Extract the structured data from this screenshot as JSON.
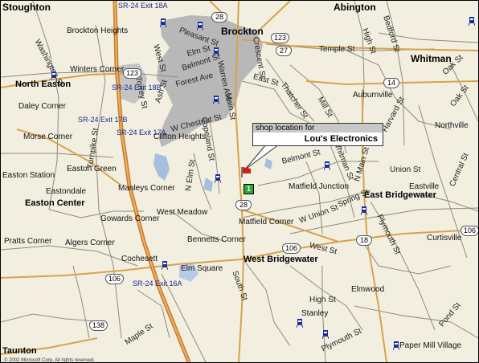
{
  "callout": {
    "header": "shop location for",
    "business": "Lou's Electronics"
  },
  "marker": {
    "number": "1",
    "flag_color": "#d51c1c",
    "pin_color": "#2ea82e"
  },
  "places_major": [
    "Stoughton",
    "Brockton",
    "Abington",
    "Whitman",
    "North Easton",
    "Easton Center",
    "East Bridgewater",
    "West Bridgewater",
    "Taunton"
  ],
  "places_minor": [
    "Brockton Heights",
    "Winters Corner",
    "Daley Corner",
    "Morse Corner",
    "Easton Station",
    "Easton Green",
    "Eastondale",
    "Clifton Heights",
    "Manleys Corner",
    "West Meadow",
    "Gowards Corner",
    "Bennetts Corner",
    "Matfield Corner",
    "Matfield Junction",
    "Northville",
    "Auburnville",
    "Eastville",
    "Curtisville",
    "Pratts Corner",
    "Algers Corner",
    "Cochesett",
    "Elm Square",
    "Elmwood",
    "Stanley",
    "Paper Mill Village"
  ],
  "streets": [
    "Washington St",
    "Pleasant St",
    "West St",
    "Belmont St",
    "Forest Ave",
    "Torrey St",
    "Elm St",
    "Ash St",
    "Main St",
    "Warren Ave",
    "W Chestnut St",
    "Copeland St",
    "Turnpike St",
    "N Elm St",
    "Thatcher St",
    "East St",
    "Temple St",
    "High St",
    "Bedford St",
    "Oak St",
    "Harvard St",
    "Belmont St",
    "Union St",
    "Central St",
    "Whitman St",
    "Spring St",
    "W Union St",
    "N Main St",
    "Plymouth St",
    "Pond St",
    "Maple St",
    "West St",
    "South St",
    "High St",
    "Plymouth St",
    "Oak St",
    "Mill St",
    "Crescent St"
  ],
  "routes": [
    "SR-24 Exit 18A",
    "SR-24 Exit 18B",
    "SR-24 Exit 17B",
    "SR-24 Exit 17A",
    "SR-24 Exit 16A"
  ],
  "route_shields": [
    "28",
    "123",
    "27",
    "14",
    "28",
    "106",
    "106",
    "18",
    "138",
    "106",
    "123"
  ],
  "copyright": "© 2002 Microsoft Corp. All rights reserved.",
  "colors": {
    "background": "#f2efe1",
    "major_road": "#d8a24a",
    "highway": "#cc7a2a",
    "water": "#a5bfdd",
    "urban": "#b4b4b4",
    "route_text": "#1a2a8a"
  }
}
